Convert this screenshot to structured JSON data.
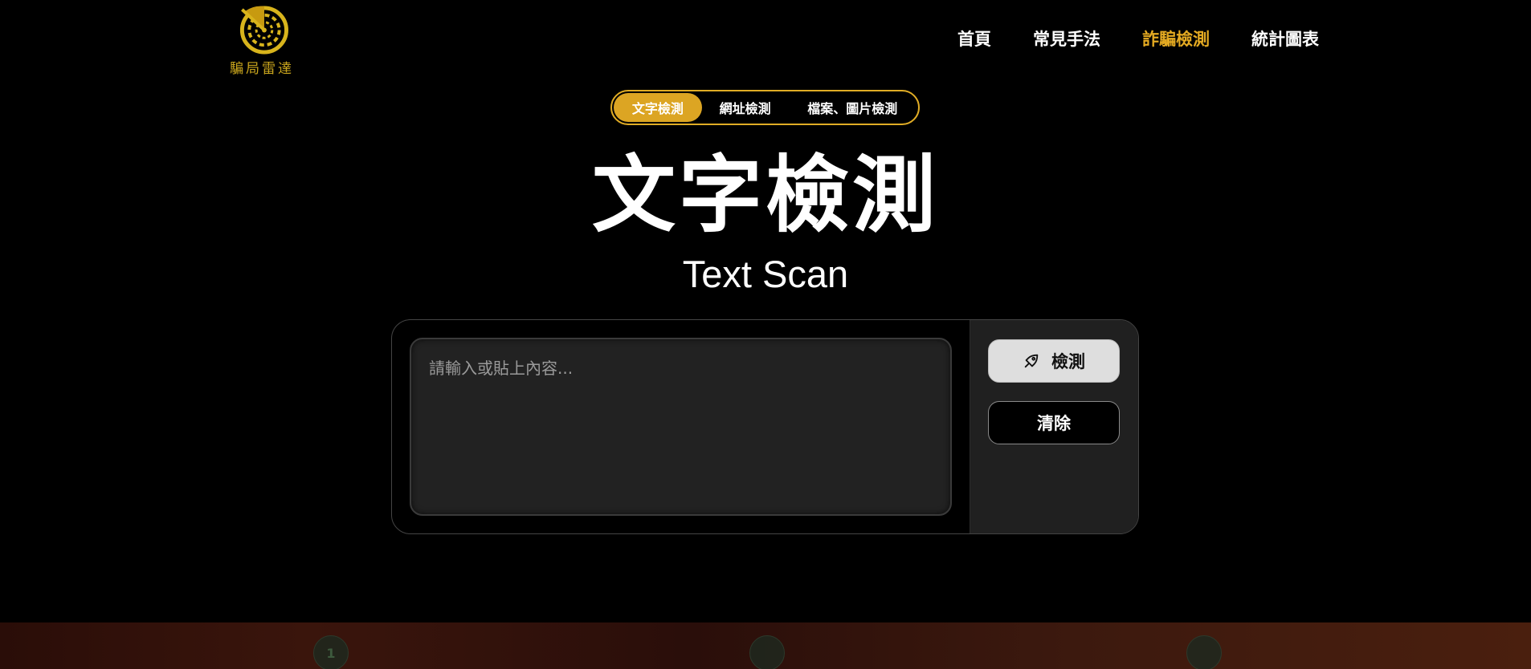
{
  "logo": {
    "text": "騙局雷達",
    "color": "#c9a51d",
    "icon": "radar-icon"
  },
  "nav": {
    "items": [
      {
        "label": "首頁",
        "active": false
      },
      {
        "label": "常見手法",
        "active": false
      },
      {
        "label": "詐騙檢測",
        "active": true
      },
      {
        "label": "統計圖表",
        "active": false
      }
    ]
  },
  "tabs": [
    {
      "label": "文字檢測",
      "active": true
    },
    {
      "label": "網址檢測",
      "active": false
    },
    {
      "label": "檔案、圖片檢測",
      "active": false
    }
  ],
  "title": {
    "zh": "文字檢測",
    "en": "Text Scan"
  },
  "scan": {
    "placeholder": "請輸入或貼上內容...",
    "value": "",
    "scan_button": "檢測",
    "scan_icon": "rocket-icon",
    "clear_button": "清除"
  },
  "bottom_strip": {
    "step_1": "1"
  },
  "colors": {
    "accent": "#e0ac25",
    "background": "#000000",
    "panel": "#202020"
  }
}
